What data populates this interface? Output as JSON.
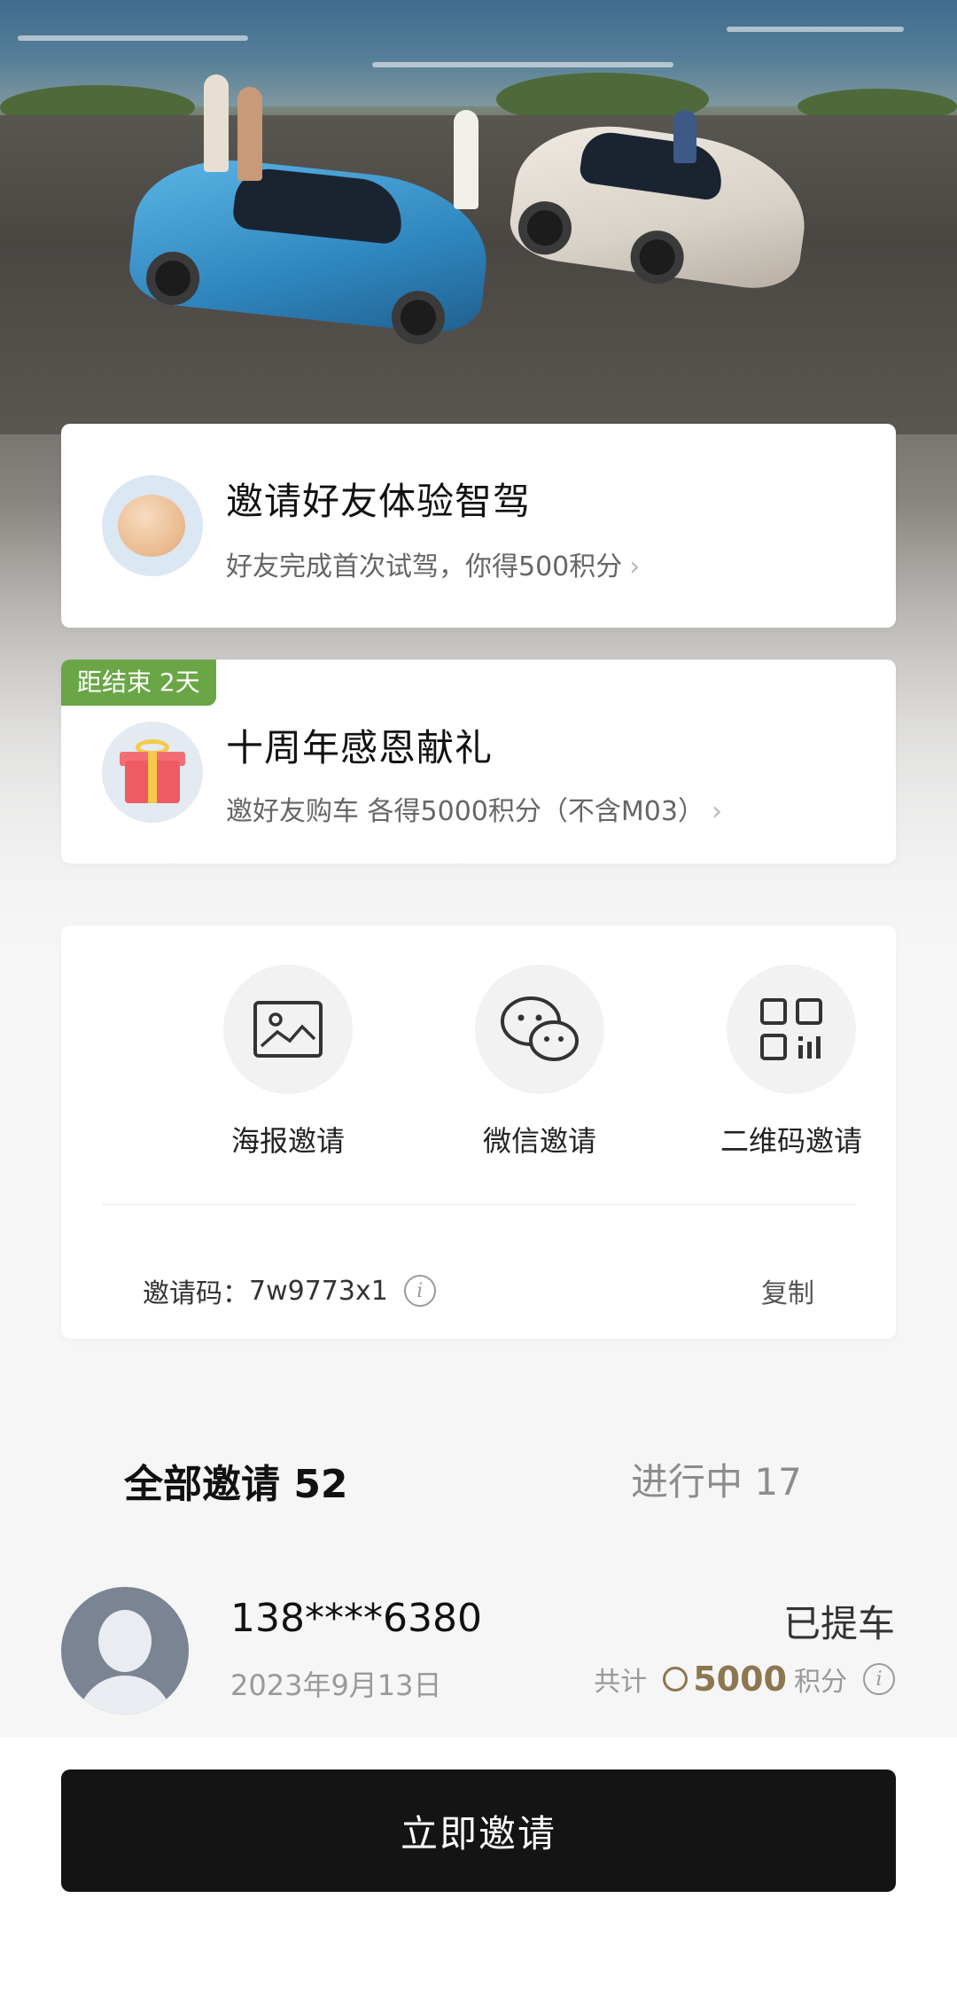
{
  "promo_invite": {
    "title": "邀请好友体验智驾",
    "subtitle": "好友完成首次试驾，你得500积分",
    "chevron": "›"
  },
  "promo_anniversary": {
    "badge": "距结束 2天",
    "title": "十周年感恩献礼",
    "subtitle": "邀好友购车 各得5000积分（不含M03）",
    "chevron": "›"
  },
  "share": {
    "items": [
      {
        "label": "海报邀请",
        "icon": "image-icon"
      },
      {
        "label": "微信邀请",
        "icon": "wechat-icon"
      },
      {
        "label": "二维码邀请",
        "icon": "qrcode-icon"
      }
    ],
    "invite_code_label": "邀请码：",
    "invite_code": "7w9773x1",
    "copy_label": "复制"
  },
  "tabs": {
    "all": "全部邀请 52",
    "in_progress": "进行中 17"
  },
  "invites": [
    {
      "phone": "138****6380",
      "date": "2023年9月13日",
      "status": "已提车",
      "total_label": "共计",
      "points": "5000",
      "points_unit": "积分"
    }
  ],
  "cta": {
    "label": "立即邀请"
  },
  "colors": {
    "badge_green": "#6aa646",
    "points_gold": "#8d7750",
    "cta_black": "#141414"
  }
}
